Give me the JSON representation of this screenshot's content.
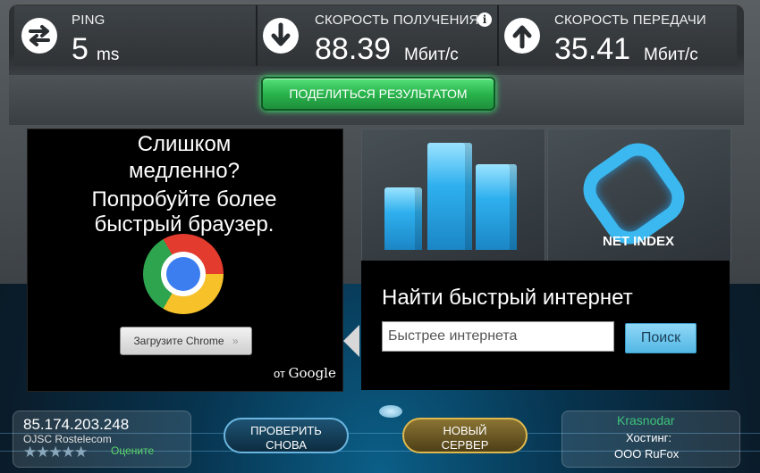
{
  "results": {
    "ping": {
      "label": "PING",
      "value": "5",
      "unit": "ms",
      "icon": "arrows-swap-icon"
    },
    "download": {
      "label": "СКОРОСТЬ ПОЛУЧЕНИЯ",
      "value": "88.39",
      "unit": "Мбит/с",
      "icon": "arrow-down-icon",
      "info_icon": "info-icon"
    },
    "upload": {
      "label": "СКОРОСТЬ ПЕРЕДАЧИ",
      "value": "35.41",
      "unit": "Мбит/с",
      "icon": "arrow-up-icon"
    }
  },
  "share_button": "ПОДЕЛИТЬСЯ РЕЗУЛЬТАТОМ",
  "ad": {
    "line1": "Слишком",
    "line2": "медленно?",
    "line3": "Попробуйте более",
    "line4": "быстрый браузер.",
    "download_button": "Загрузите Chrome",
    "by": "от",
    "brand": "Google"
  },
  "net_index": {
    "label": "NET INDEX"
  },
  "search": {
    "title": "Найти быстрый интернет",
    "input_value": "Быстрее интернета",
    "button": "Поиск"
  },
  "client": {
    "ip": "85.174.203.248",
    "isp": "OJSC Rostelecom",
    "rate_label": "Оцените",
    "rating": 0
  },
  "buttons": {
    "retest_line1": "ПРОВЕРИТЬ",
    "retest_line2": "СНОВА",
    "new_server_line1": "НОВЫЙ",
    "new_server_line2": "СЕРВЕР"
  },
  "server": {
    "city": "Krasnodar",
    "hosting_label": "Хостинг:",
    "host": "ООО RuFox"
  },
  "colors": {
    "accent_green": "#2fc25a",
    "accent_blue": "#2fb0ee",
    "city_green": "#3ec27a"
  }
}
